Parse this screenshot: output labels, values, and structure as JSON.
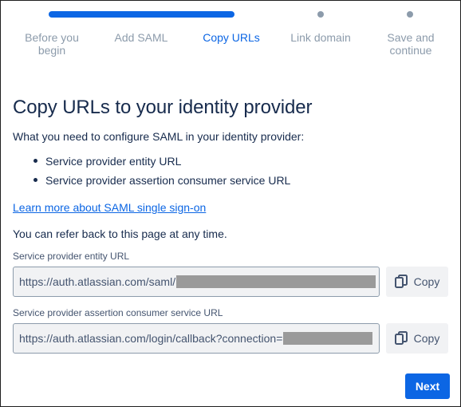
{
  "progress": {
    "steps": [
      {
        "label_line1": "Before you",
        "label_line2": "begin"
      },
      {
        "label_line1": "Add SAML",
        "label_line2": ""
      },
      {
        "label_line1": "Copy URLs",
        "label_line2": ""
      },
      {
        "label_line1": "Link domain",
        "label_line2": ""
      },
      {
        "label_line1": "Save and",
        "label_line2": "continue"
      }
    ],
    "active_step": 3
  },
  "page": {
    "title": "Copy URLs to your identity provider",
    "intro": "What you need to configure SAML in your identity provider:",
    "requirements": [
      "Service provider entity URL",
      "Service provider assertion consumer service URL"
    ],
    "learn_more_link": "Learn more about SAML single sign-on",
    "refer_note": "You can refer back to this page at any time."
  },
  "fields": {
    "entity": {
      "label": "Service provider entity URL",
      "value": "https://auth.atlassian.com/saml/",
      "copy_label": "Copy"
    },
    "acs": {
      "label": "Service provider assertion consumer service URL",
      "value": "https://auth.atlassian.com/login/callback?connection=",
      "copy_label": "Copy"
    }
  },
  "footer": {
    "next_label": "Next"
  },
  "colors": {
    "accent": "#0c66e4",
    "muted": "#8c9bab",
    "text": "#172b4d"
  }
}
